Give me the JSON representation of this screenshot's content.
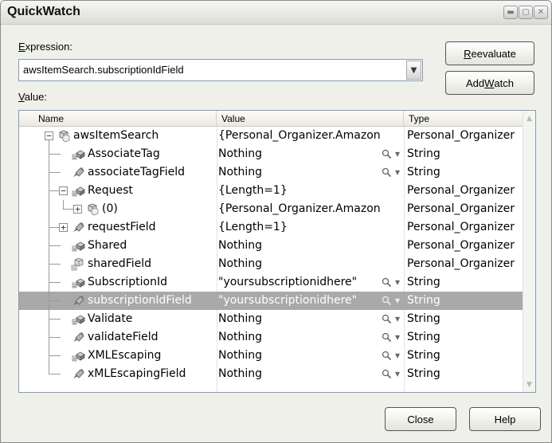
{
  "window": {
    "title": "QuickWatch",
    "controls": [
      "minimize",
      "maximize",
      "close"
    ]
  },
  "expression": {
    "label_prefix": "",
    "label_accel": "E",
    "label_rest": "xpression:",
    "value": "awsItemSearch.subscriptionIdField"
  },
  "value_label": {
    "accel": "V",
    "rest": "alue:"
  },
  "buttons": {
    "reevaluate_accel": "R",
    "reevaluate_rest": "eevaluate",
    "add_watch_prefix": "Add ",
    "add_watch_accel": "W",
    "add_watch_rest": "atch",
    "close": "Close",
    "help": "Help"
  },
  "grid": {
    "columns": [
      "Name",
      "Value",
      "Type"
    ],
    "rows": [
      {
        "name": "awsItemSearch",
        "value": "{Personal_Organizer.Amazon",
        "type": "Personal_Organizer",
        "depth": 0,
        "expander": "−",
        "icon": "object-icon",
        "magnify": false,
        "selected": false
      },
      {
        "name": "AssociateTag",
        "value": "Nothing",
        "type": "String",
        "depth": 1,
        "expander": "",
        "icon": "property-icon",
        "magnify": true,
        "selected": false
      },
      {
        "name": "associateTagField",
        "value": "Nothing",
        "type": "String",
        "depth": 1,
        "expander": "",
        "icon": "field-icon",
        "magnify": true,
        "selected": false
      },
      {
        "name": "Request",
        "value": "{Length=1}",
        "type": "Personal_Organizer",
        "depth": 1,
        "expander": "−",
        "icon": "property-icon",
        "magnify": false,
        "selected": false
      },
      {
        "name": "(0)",
        "value": "{Personal_Organizer.Amazon",
        "type": "Personal_Organizer",
        "depth": 2,
        "expander": "+",
        "icon": "object-icon",
        "magnify": false,
        "selected": false
      },
      {
        "name": "requestField",
        "value": "{Length=1}",
        "type": "Personal_Organizer",
        "depth": 1,
        "expander": "+",
        "icon": "field-icon",
        "magnify": false,
        "selected": false
      },
      {
        "name": "Shared",
        "value": "Nothing",
        "type": "Personal_Organizer",
        "depth": 1,
        "expander": "",
        "icon": "property-icon",
        "magnify": false,
        "selected": false
      },
      {
        "name": "sharedField",
        "value": "Nothing",
        "type": "Personal_Organizer",
        "depth": 1,
        "expander": "",
        "icon": "shared-icon",
        "magnify": false,
        "selected": false
      },
      {
        "name": "SubscriptionId",
        "value": "\"yoursubscriptionidhere\"",
        "type": "String",
        "depth": 1,
        "expander": "",
        "icon": "property-icon",
        "magnify": true,
        "selected": false
      },
      {
        "name": "subscriptionIdField",
        "value": "\"yoursubscriptionidhere\"",
        "type": "String",
        "depth": 1,
        "expander": "",
        "icon": "field-icon",
        "magnify": true,
        "selected": true
      },
      {
        "name": "Validate",
        "value": "Nothing",
        "type": "String",
        "depth": 1,
        "expander": "",
        "icon": "property-icon",
        "magnify": true,
        "selected": false
      },
      {
        "name": "validateField",
        "value": "Nothing",
        "type": "String",
        "depth": 1,
        "expander": "",
        "icon": "field-icon",
        "magnify": true,
        "selected": false
      },
      {
        "name": "XMLEscaping",
        "value": "Nothing",
        "type": "String",
        "depth": 1,
        "expander": "",
        "icon": "property-icon",
        "magnify": true,
        "selected": false
      },
      {
        "name": "xMLEscapingField",
        "value": "Nothing",
        "type": "String",
        "depth": 1,
        "expander": "",
        "icon": "field-icon",
        "magnify": true,
        "selected": false
      }
    ]
  },
  "colors": {
    "selected_row": "#a9a9a9",
    "dialog_bg": "#f0f0ea",
    "border_blue": "#7f9db9"
  }
}
